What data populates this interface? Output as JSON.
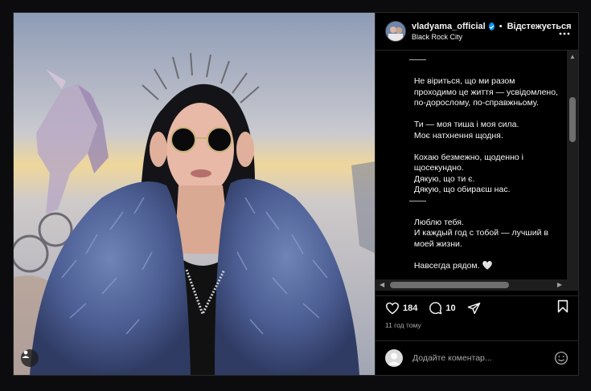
{
  "header": {
    "username": "vladyama_official",
    "separator": "•",
    "follow_label": "Відстежується",
    "location": "Black Rock City"
  },
  "caption": {
    "text": "——\n\n  Не віриться, що ми разом\n  проходимо це життя — усвідомлено,\n  по-дорослому, по-справжньому.\n\n  Ти — моя тиша і моя сила.\n  Моє натхнення щодня.\n\n  Кохаю безмежно, щоденно і\n  щосекундно.\n  Дякую, що ти є.\n  Дякую, що обираєш нас.\n——\n\n  Люблю тебя.\n  И каждый год с тобой — лучший в\n  моей жизни.\n\n  Навсегда рядом. 🤍"
  },
  "actions": {
    "likes": "184",
    "comments": "10"
  },
  "timestamp": "11 год тому",
  "comment_box": {
    "placeholder": "Додайте коментар..."
  },
  "icons": [
    "verified-badge-icon",
    "more-options-icon",
    "heart-icon",
    "comment-icon",
    "share-icon",
    "bookmark-icon",
    "emoji-icon",
    "user-tag-icon"
  ],
  "colors": {
    "background": "#000000",
    "accent": "#0095f6",
    "page": "#0c0c0e"
  }
}
